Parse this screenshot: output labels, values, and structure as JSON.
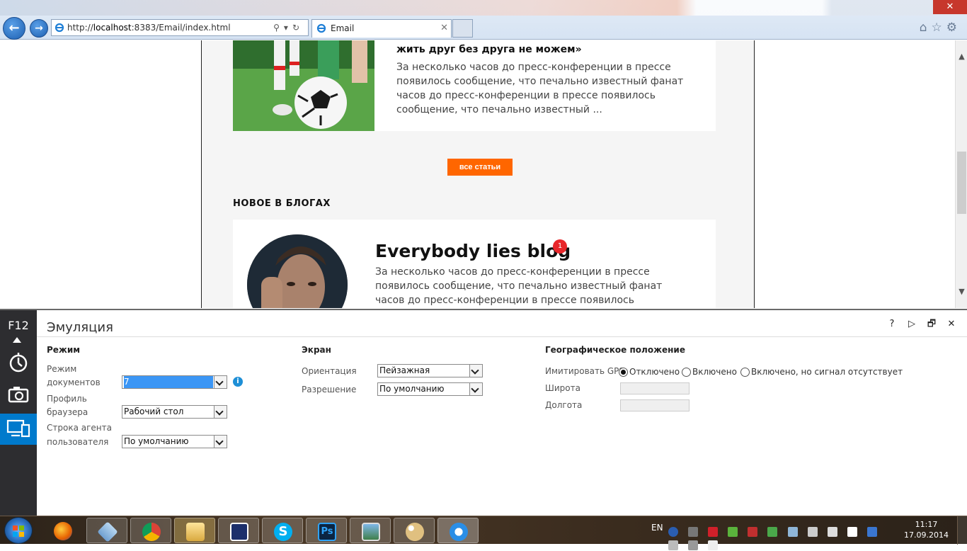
{
  "browser": {
    "url_prefix": "http://",
    "url_host": "localhost",
    "url_rest": ":8383/Email/index.html",
    "tab_title": "Email",
    "window_close": "✕"
  },
  "page": {
    "article": {
      "title": "жить друг без друга не можем»",
      "text": "За несколько часов до пресс-конференции в прессе появилось сообщение, что печально известный фанат часов до пресс-конференции в прессе появилось сообщение, что печально известный ..."
    },
    "all_articles_button": "все статьи",
    "blogs_heading": "НОВОЕ В БЛОГАХ",
    "blog": {
      "title": "Everybody lies blog",
      "badge": "1",
      "text": "За несколько часов до пресс-конференции в прессе появилось сообщение, что печально известный фанат часов до пресс-конференции в прессе появилось"
    }
  },
  "devtools": {
    "rail_label": "F12",
    "title": "Эмуляция",
    "actions": [
      "?",
      "▷",
      "🗗",
      "✕"
    ],
    "mode": {
      "heading": "Режим",
      "doc_mode_label_1": "Режим",
      "doc_mode_label_2": "документов",
      "doc_mode_value": "7",
      "browser_profile_label_1": "Профиль",
      "browser_profile_label_2": "браузера",
      "browser_profile_value": "Рабочий стол",
      "user_agent_label_1": "Строка агента",
      "user_agent_label_2": "пользователя",
      "user_agent_value": "По умолчанию"
    },
    "screen": {
      "heading": "Экран",
      "orientation_label": "Ориентация",
      "orientation_value": "Пейзажная",
      "resolution_label": "Разрешение",
      "resolution_value": "По умолчанию"
    },
    "geo": {
      "heading": "Географическое положение",
      "simulate_gps_label": "Имитировать GPS",
      "option_off": "Отключено",
      "option_on": "Включено",
      "option_no_signal": "Включено, но сигнал отсутствует",
      "selected": "off",
      "latitude_label": "Широта",
      "longitude_label": "Долгота"
    }
  },
  "taskbar": {
    "language": "EN",
    "time": "11:17",
    "date": "17.09.2014"
  },
  "colors": {
    "accent_orange": "#ff6600",
    "devtools_active": "#007acc",
    "badge_red": "#e8262a"
  }
}
